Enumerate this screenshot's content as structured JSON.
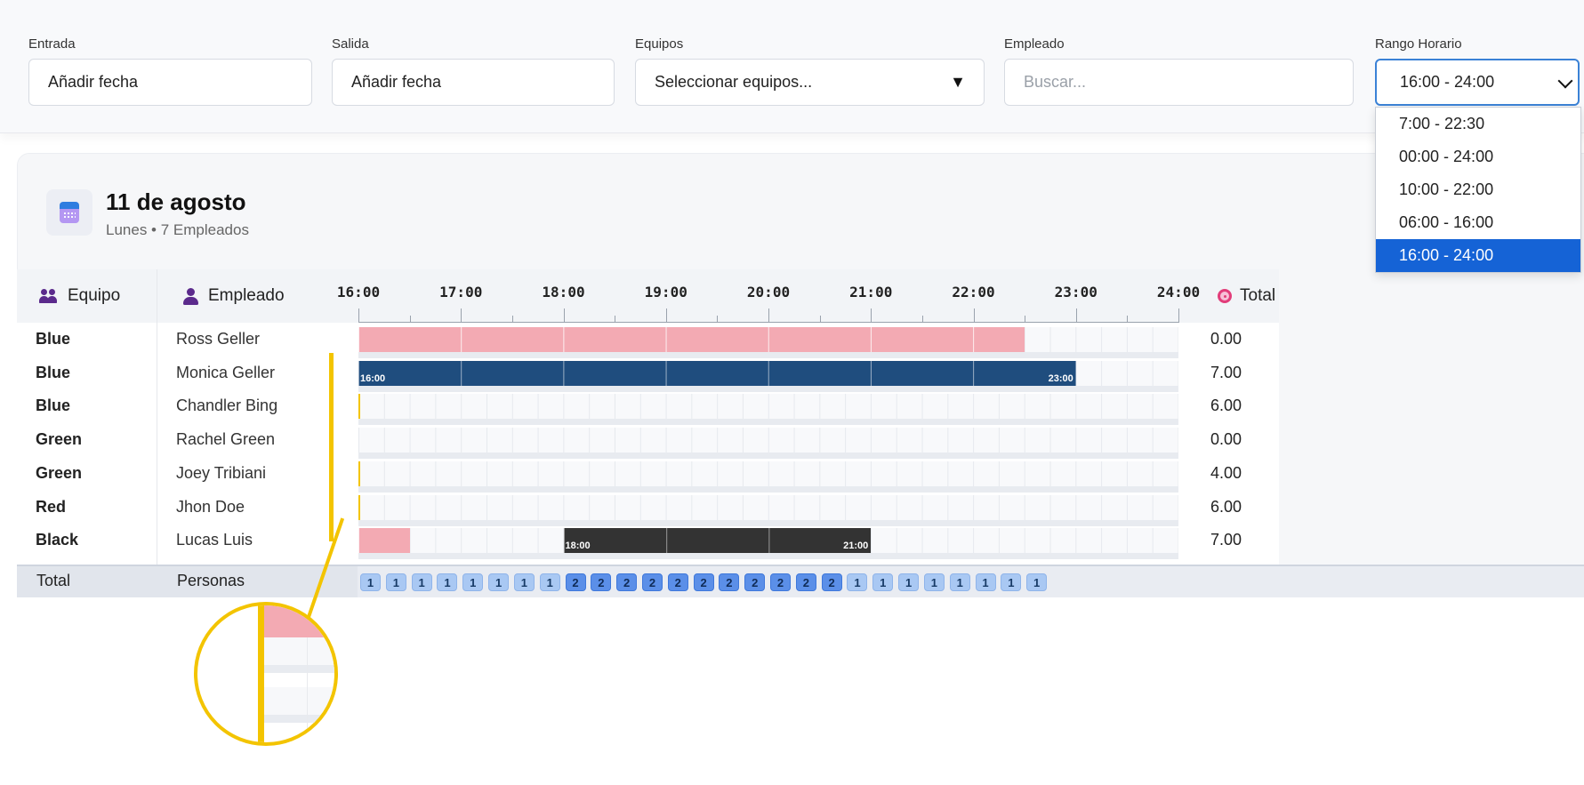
{
  "filters": {
    "entrada": {
      "label": "Entrada",
      "value": "Añadir fecha"
    },
    "salida": {
      "label": "Salida",
      "value": "Añadir fecha"
    },
    "equipos": {
      "label": "Equipos",
      "value": "Seleccionar equipos..."
    },
    "empleado": {
      "label": "Empleado",
      "placeholder": "Buscar..."
    },
    "rango": {
      "label": "Rango Horario",
      "value": "16:00 - 24:00",
      "options": [
        "7:00 - 22:30",
        "00:00 - 24:00",
        "10:00 - 22:00",
        "06:00 - 16:00",
        "16:00 - 24:00"
      ],
      "selected_index": 4
    }
  },
  "day": {
    "title": "11 de agosto",
    "subtitle": "Lunes • 7 Empleados"
  },
  "table": {
    "headers": {
      "team": "Equipo",
      "employee": "Empleado",
      "total": "Total"
    },
    "axis": {
      "start": 16,
      "end": 24,
      "ticks": [
        "16:00",
        "17:00",
        "18:00",
        "19:00",
        "20:00",
        "21:00",
        "22:00",
        "23:00",
        "24:00"
      ]
    },
    "rows": [
      {
        "team": "Blue",
        "employee": "Ross Geller",
        "total": "0.00",
        "bars": [
          {
            "start": 16,
            "end": 22.5,
            "style": "pink"
          }
        ]
      },
      {
        "team": "Blue",
        "employee": "Monica Geller",
        "total": "7.00",
        "bars": [
          {
            "start": 16,
            "end": 23,
            "style": "navy",
            "start_label": "16:00",
            "end_label": "23:00"
          }
        ]
      },
      {
        "team": "Blue",
        "employee": "Chandler Bing",
        "total": "6.00",
        "bars": [],
        "mark": true
      },
      {
        "team": "Green",
        "employee": "Rachel Green",
        "total": "0.00",
        "bars": []
      },
      {
        "team": "Green",
        "employee": "Joey Tribiani",
        "total": "4.00",
        "bars": [],
        "mark": true
      },
      {
        "team": "Red",
        "employee": "Jhon Doe",
        "total": "6.00",
        "bars": [],
        "mark": true
      },
      {
        "team": "Black",
        "employee": "Lucas Luis",
        "total": "7.00",
        "bars": [
          {
            "start": 16,
            "end": 16.5,
            "style": "pink"
          },
          {
            "start": 18,
            "end": 21,
            "style": "dark",
            "start_label": "18:00",
            "end_label": "21:00"
          }
        ]
      }
    ],
    "totals": {
      "label": "Total",
      "sublabel": "Personas",
      "counts": [
        1,
        1,
        1,
        1,
        1,
        1,
        1,
        1,
        2,
        2,
        2,
        2,
        2,
        2,
        2,
        2,
        2,
        2,
        2,
        1,
        1,
        1,
        1,
        1,
        1,
        1,
        1
      ]
    }
  },
  "colors": {
    "accent": "#1563d6",
    "pink": "#f3aab3",
    "navy": "#1f4d7e",
    "dark": "#333333",
    "highlight": "#f3c400"
  },
  "icons": [
    "team-icon",
    "employee-icon",
    "clock-icon",
    "calendar-icon",
    "chevron-down-icon",
    "caret-down-icon",
    "magnifier-callout"
  ]
}
